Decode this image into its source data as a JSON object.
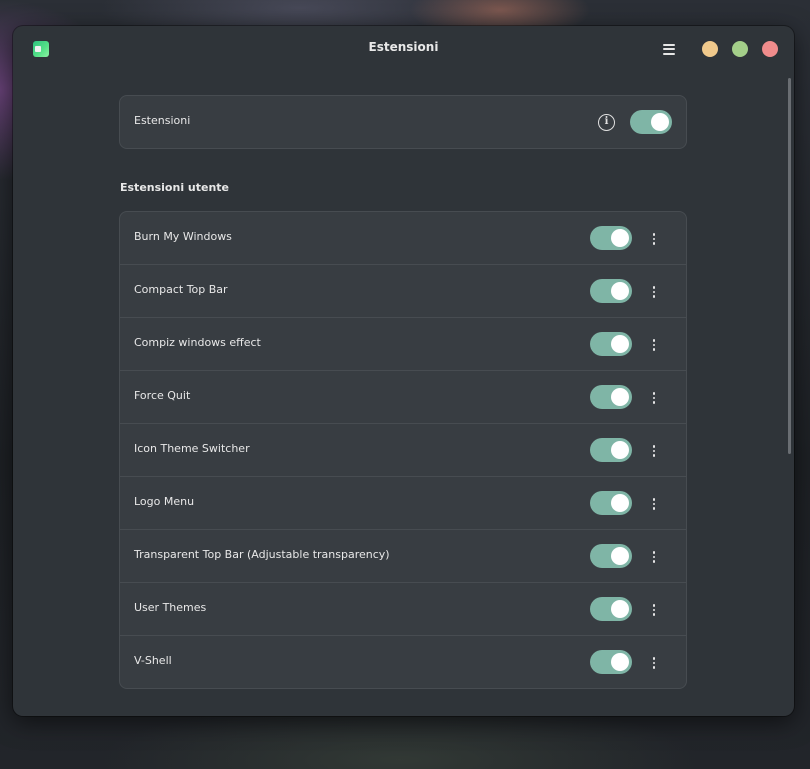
{
  "window": {
    "title": "Estensioni"
  },
  "master": {
    "label": "Estensioni",
    "info_icon": "i",
    "enabled": true
  },
  "user_section": {
    "title": "Estensioni utente",
    "items": [
      {
        "label": "Burn My Windows",
        "enabled": true
      },
      {
        "label": "Compact Top Bar",
        "enabled": true
      },
      {
        "label": "Compiz windows effect",
        "enabled": true
      },
      {
        "label": "Force Quit",
        "enabled": true
      },
      {
        "label": "Icon Theme Switcher",
        "enabled": true
      },
      {
        "label": "Logo Menu",
        "enabled": true
      },
      {
        "label": "Transparent Top Bar (Adjustable transparency)",
        "enabled": true
      },
      {
        "label": "User Themes",
        "enabled": true
      },
      {
        "label": "V-Shell",
        "enabled": true
      }
    ]
  },
  "colors": {
    "window_bg": "#2f3439",
    "card_bg": "#383d42",
    "switch_on": "#7fb5a6",
    "close": "#f08c8c",
    "maximize": "#a4cf8a",
    "minimize": "#f0c98c"
  }
}
